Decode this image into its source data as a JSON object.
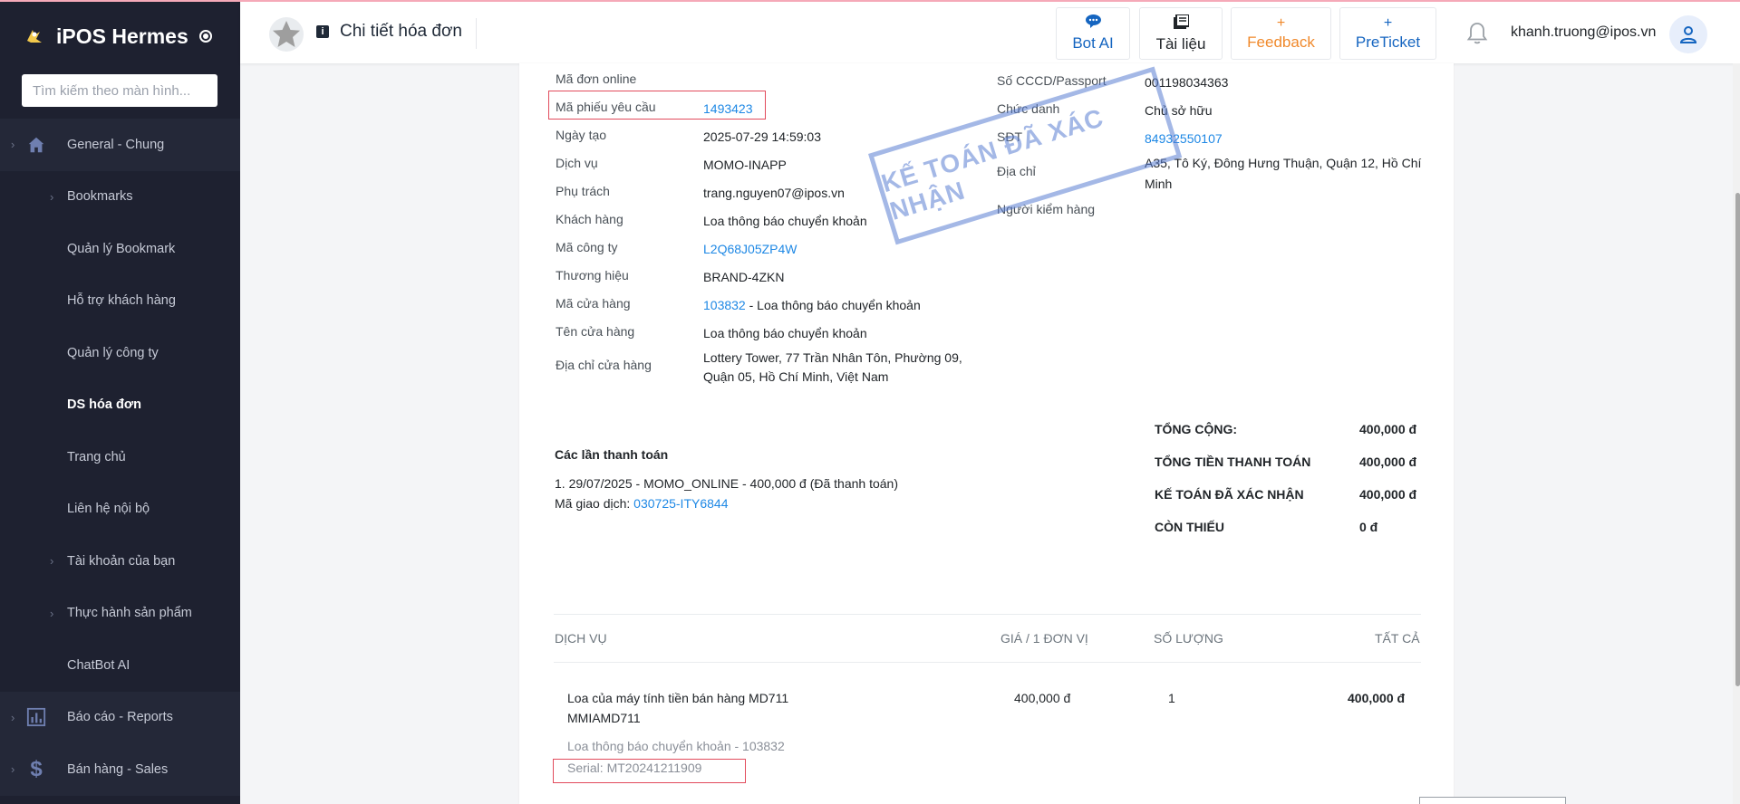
{
  "sidebar": {
    "brand": "iPOS Hermes",
    "search_placeholder": "Tìm kiếm theo màn hình...",
    "items": [
      {
        "label": "General - Chung",
        "icon": "home-icon",
        "level": "group"
      },
      {
        "label": "Bookmarks",
        "level": "sub-expand"
      },
      {
        "label": "Quản lý Bookmark",
        "level": "sub"
      },
      {
        "label": "Hỗ trợ khách hàng",
        "level": "sub"
      },
      {
        "label": "Quản lý công ty",
        "level": "sub"
      },
      {
        "label": "DS hóa đơn",
        "level": "sub",
        "active": true
      },
      {
        "label": "Trang chủ",
        "level": "sub"
      },
      {
        "label": "Liên hệ nội bộ",
        "level": "sub"
      },
      {
        "label": "Tài khoản của bạn",
        "level": "sub-expand"
      },
      {
        "label": "Thực hành sản phẩm",
        "level": "sub-expand"
      },
      {
        "label": "ChatBot AI",
        "level": "sub"
      },
      {
        "label": "Báo cáo - Reports",
        "icon": "chart-icon",
        "level": "group"
      },
      {
        "label": "Bán hàng - Sales",
        "icon": "dollar-icon",
        "level": "group"
      }
    ]
  },
  "header": {
    "page_title": "Chi tiết hóa đơn",
    "buttons": {
      "bot_ai": "Bot AI",
      "docs": "Tài liệu",
      "feedback": "Feedback",
      "preticket": "PreTicket"
    },
    "user_email": "khanh.truong@ipos.vn"
  },
  "invoice": {
    "left": [
      {
        "key": "Mã đơn online",
        "value": ""
      },
      {
        "key": "Mã phiếu yêu cầu",
        "value": "1493423",
        "link": true
      },
      {
        "key": "Ngày tạo",
        "value": "2025-07-29 14:59:03"
      },
      {
        "key": "Dịch vụ",
        "value": "MOMO-INAPP"
      },
      {
        "key": "Phụ trách",
        "value": "trang.nguyen07@ipos.vn"
      },
      {
        "key": "Khách hàng",
        "value": "Loa thông báo chuyển khoản"
      },
      {
        "key": "Mã công ty",
        "value": "L2Q68J05ZP4W",
        "link": true
      },
      {
        "key": "Thương hiệu",
        "value": "BRAND-4ZKN"
      },
      {
        "key": "Mã cửa hàng",
        "value_link": "103832",
        "value_rest": " - Loa thông báo chuyển khoản"
      },
      {
        "key": "Tên cửa hàng",
        "value": "Loa thông báo chuyển khoản"
      },
      {
        "key": "Địa chỉ cửa hàng",
        "value": "Lottery Tower, 77 Trần Nhân Tôn, Phường 09, Quận 05, Hồ Chí Minh, Việt Nam"
      }
    ],
    "right": [
      {
        "key": "Số CCCD/Passport",
        "value": "001198034363"
      },
      {
        "key": "Chức danh",
        "value": "Chủ sở hữu"
      },
      {
        "key": "SĐT",
        "value": "84932550107",
        "link": true
      },
      {
        "key": "Địa chỉ",
        "value": "A35, Tô Ký, Đông Hưng Thuận, Quận 12, Hồ Chí Minh"
      },
      {
        "key": "Người kiểm hàng",
        "value": ""
      }
    ],
    "stamp_text": "KẾ TOÁN ĐÃ XÁC NHẬN",
    "payments_title": "Các lần thanh toán",
    "payment_line": "1. 29/07/2025 - MOMO_ONLINE - 400,000 đ (Đã thanh toán)",
    "transaction_label": "Mã giao dịch: ",
    "transaction_code": "030725-ITY6844",
    "totals": [
      {
        "label": "TỔNG CỘNG:",
        "value": "400,000 đ"
      },
      {
        "label": "TỔNG TIỀN THANH TOÁN",
        "value": "400,000 đ"
      },
      {
        "label": "KẾ TOÁN ĐÃ XÁC NHẬN",
        "value": "400,000 đ"
      },
      {
        "label": "CÒN THIẾU",
        "value": "0 đ"
      }
    ],
    "table": {
      "headers": [
        "DỊCH VỤ",
        "GIÁ / 1 ĐƠN VỊ",
        "SỐ LƯỢNG",
        "TẤT CẢ"
      ],
      "row": {
        "name": "Loa của máy tính tiền bán hàng MD711",
        "code": "MMIAMD711",
        "price": "400,000 đ",
        "qty": "1",
        "total": "400,000 đ",
        "store": "Loa thông báo chuyển khoản - 103832",
        "serial": "Serial: MT20241211909"
      }
    }
  },
  "colors": {
    "sidebar_bg": "#1e2130",
    "link": "#1e88e5",
    "highlight_border": "#e24b5c",
    "stamp": "#5a7dd2",
    "feedback": "#f0892b",
    "primary": "#1565c0"
  }
}
